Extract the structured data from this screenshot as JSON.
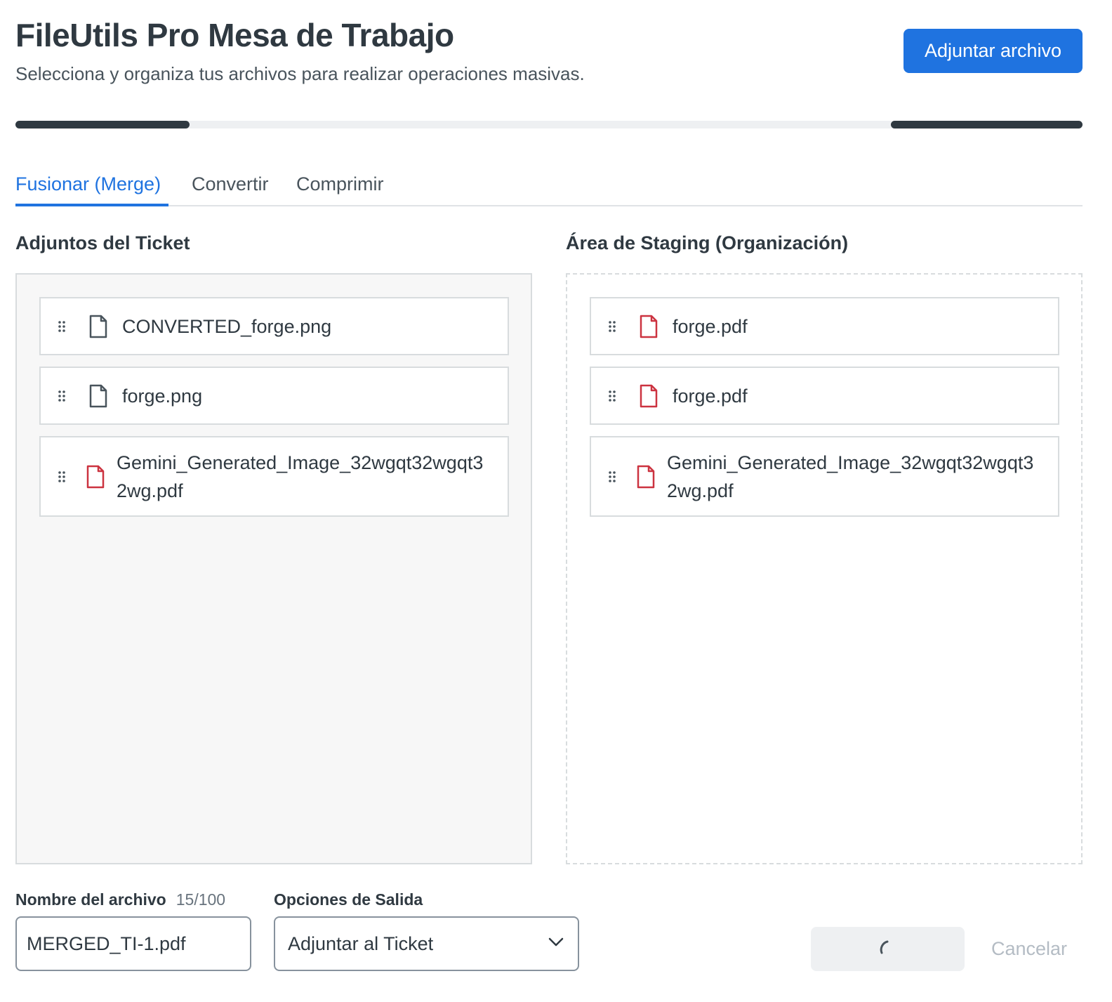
{
  "header": {
    "title": "FileUtils Pro Mesa de Trabajo",
    "subtitle": "Selecciona y organiza tus archivos para realizar operaciones masivas.",
    "attach_button": "Adjuntar archivo"
  },
  "tabs": [
    {
      "label": "Fusionar (Merge)",
      "active": true
    },
    {
      "label": "Convertir",
      "active": false
    },
    {
      "label": "Comprimir",
      "active": false
    }
  ],
  "left_panel": {
    "title": "Adjuntos del Ticket",
    "items": [
      {
        "name": "CONVERTED_forge.png",
        "icon": "file-icon"
      },
      {
        "name": "forge.png",
        "icon": "file-icon"
      },
      {
        "name": "Gemini_Generated_Image_32wgqt32wgqt32wg.pdf",
        "icon": "pdf-file-icon"
      }
    ]
  },
  "right_panel": {
    "title": "Área de Staging (Organización)",
    "items": [
      {
        "name": "forge.pdf",
        "icon": "pdf-file-icon"
      },
      {
        "name": "forge.pdf",
        "icon": "pdf-file-icon"
      },
      {
        "name": "Gemini_Generated_Image_32wgqt32wgqt32wg.pdf",
        "icon": "pdf-file-icon"
      }
    ]
  },
  "footer": {
    "filename_label": "Nombre del archivo",
    "filename_counter": "15/100",
    "filename_value": "MERGED_TI-1.pdf",
    "output_label": "Opciones de Salida",
    "output_value": "Adjuntar al Ticket",
    "cancel_label": "Cancelar"
  },
  "colors": {
    "accent": "#1f73e0",
    "pdf_icon": "#cc3340",
    "text": "#2f3941"
  }
}
